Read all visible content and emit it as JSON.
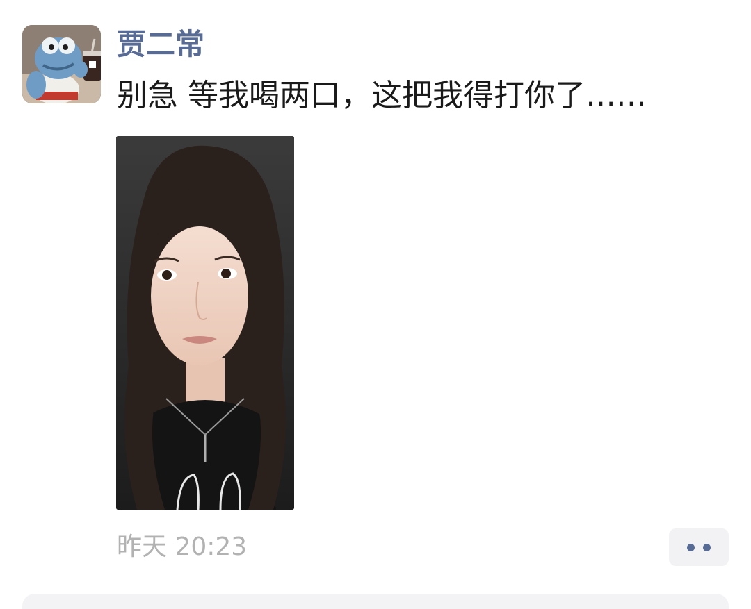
{
  "post": {
    "author_name": "贾二常",
    "text": "别急 等我喝两口，这把我得打你了……",
    "timestamp": "昨天 20:23"
  },
  "icons": {
    "more": "more-dots-icon"
  },
  "colors": {
    "author_link": "#576b95",
    "timestamp": "#b2b2b2",
    "more_button_bg": "#f2f2f4"
  }
}
